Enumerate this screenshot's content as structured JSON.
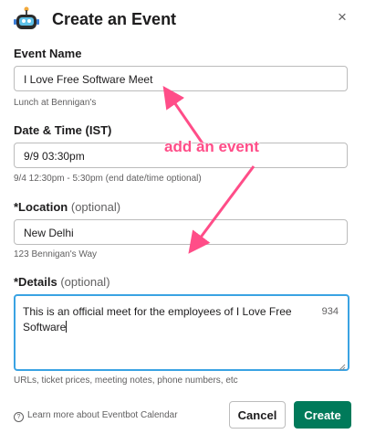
{
  "header": {
    "title": "Create an Event",
    "logo_icon": "eventbot-robot-icon",
    "close_glyph": "×"
  },
  "fields": {
    "event_name": {
      "label": "Event Name",
      "value": "I Love Free Software Meet",
      "hint": "Lunch at Bennigan's"
    },
    "date_time": {
      "label": "Date & Time (IST)",
      "value": "9/9 03:30pm",
      "hint": "9/4 12:30pm - 5:30pm (end date/time optional)"
    },
    "location": {
      "label": "*Location",
      "optional": "(optional)",
      "value": "New Delhi",
      "hint": "123 Bennigan's Way"
    },
    "details": {
      "label": "*Details",
      "optional": "(optional)",
      "value": "This is an official meet for the employees of I Love Free Software",
      "counter": "934",
      "hint": "URLs, ticket prices, meeting notes, phone numbers, etc"
    }
  },
  "footer": {
    "learn_more": "Learn more about Eventbot Calendar",
    "help_icon": "question-circle-icon",
    "cancel_label": "Cancel",
    "create_label": "Create"
  },
  "annotation": {
    "text": "add an event",
    "color": "#ff4d88"
  },
  "colors": {
    "primary": "#007a5a",
    "focus": "#3aa3e3",
    "annotation": "#ff4d88"
  }
}
